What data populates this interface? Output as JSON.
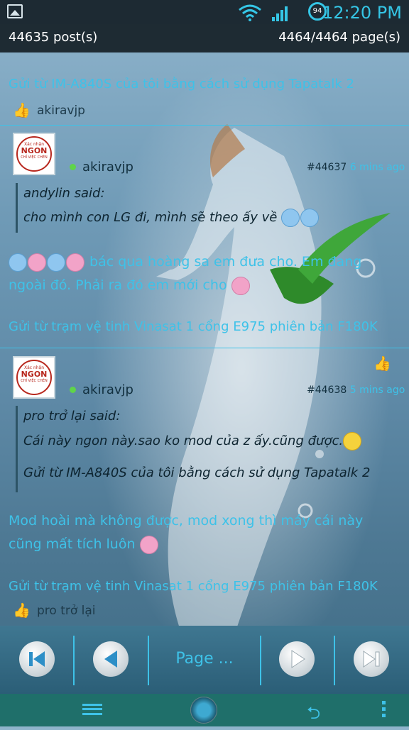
{
  "status_bar": {
    "time": "12:20 PM",
    "battery": "94"
  },
  "header": {
    "post_count": "44635 post(s)",
    "page_count": "4464/4464 page(s)"
  },
  "top_block": {
    "signature": "Gửi từ IM-A840S của tôi bằng cách sử dụng Tapatalk 2",
    "liked_by": "akiravjp"
  },
  "avatar_text": {
    "line1": "Xác nhận",
    "line2": "NGON",
    "line3": "CHỈ VIỆC CHÉN"
  },
  "posts": [
    {
      "username": "akiravjp",
      "number": "#44637",
      "time": "6 mins ago",
      "quote_author": "andylin said:",
      "quote_lines": [
        "cho mình con LG đi, mình sẽ theo ấy về"
      ],
      "body_line1": "bác qua hoàng sa em đưa cho. Em đang",
      "body_line2": "ngoài đó. Phải ra đó em mới cho",
      "signature": "Gửi từ trạm vệ tinh Vinasat 1 cổng E975 phiên bản F180K"
    },
    {
      "username": "akiravjp",
      "number": "#44638",
      "time": "5 mins ago",
      "quote_author": "pro trở lại said:",
      "quote_lines": [
        "Cái này ngon này.sao ko mod của z ấy.cũng được.",
        "Gửi từ IM-A840S của tôi bằng cách sử dụng Tapatalk 2"
      ],
      "body_line1": "Mod hoài mà không được, mod xong thì máy cái này",
      "body_line2": "cũng mất tích luôn",
      "signature": "Gửi từ trạm vệ tinh Vinasat 1 cổng E975 phiên bản F180K",
      "liked_by": "pro trở lại"
    }
  ],
  "pager": {
    "label": "Page ..."
  },
  "colors": {
    "accent": "#3ec2e8",
    "header_bg": "#1e2b33",
    "nav_bg": "#1f6f6a"
  },
  "icons": [
    "gallery-icon",
    "wifi-icon",
    "signal-icon",
    "battery-icon",
    "thumbs-up-icon",
    "first-page-icon",
    "previous-page-icon",
    "next-page-icon",
    "last-page-icon",
    "menu-icon",
    "home-icon",
    "back-icon",
    "more-icon"
  ]
}
